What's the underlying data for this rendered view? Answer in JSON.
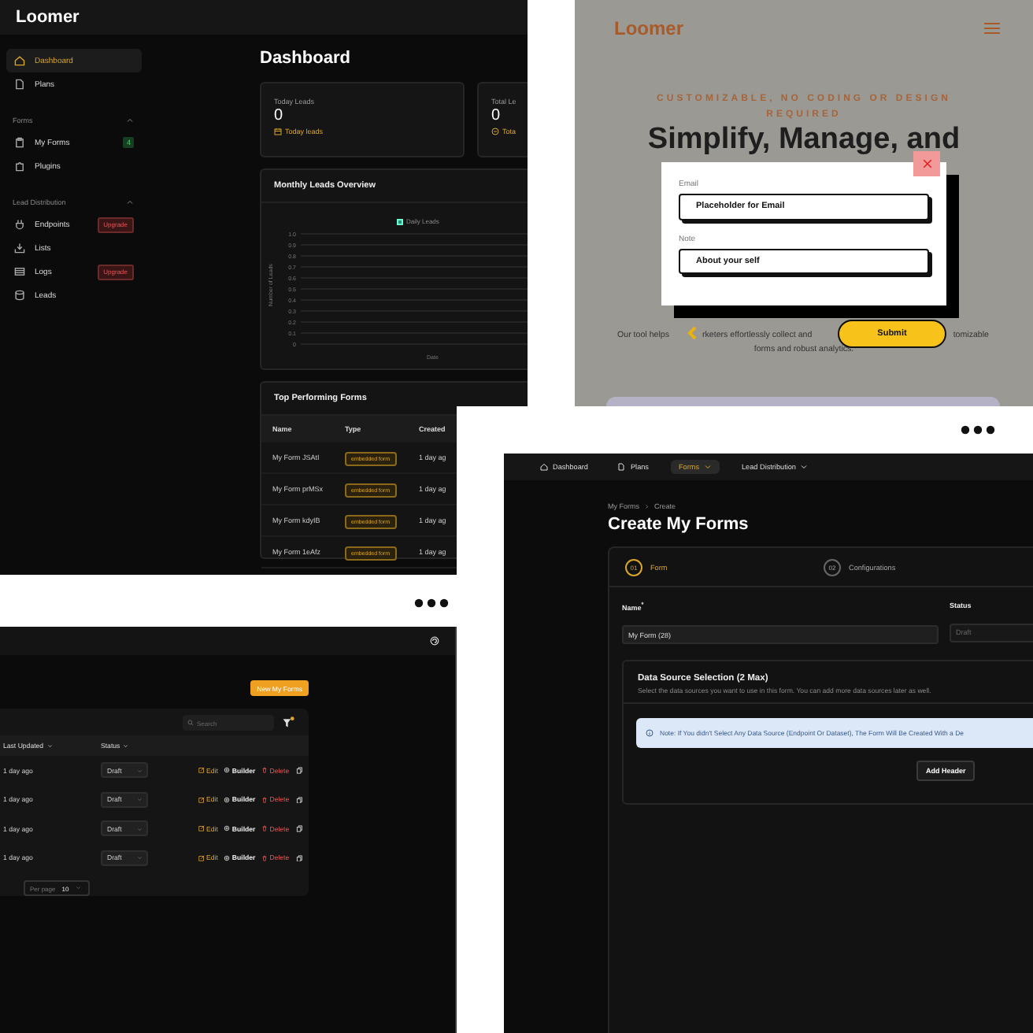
{
  "dashboard_window": {
    "logo": "Loomer",
    "sidebar": {
      "items": [
        {
          "kind": "link",
          "label": "Dashboard",
          "selected": true
        },
        {
          "kind": "link",
          "label": "Plans",
          "selected": false
        },
        {
          "kind": "section",
          "label": "Forms",
          "expanded": true
        },
        {
          "kind": "link",
          "label": "My Forms",
          "selected": false,
          "badge": {
            "kind": "count",
            "text": "4"
          }
        },
        {
          "kind": "link",
          "label": "Plugins",
          "selected": false
        },
        {
          "kind": "section",
          "label": "Lead Distribution",
          "expanded": true
        },
        {
          "kind": "link",
          "label": "Endpoints",
          "selected": false,
          "badge": {
            "kind": "upgrade",
            "text": "Upgrade"
          }
        },
        {
          "kind": "link",
          "label": "Lists",
          "selected": false
        },
        {
          "kind": "link",
          "label": "Logs",
          "selected": false,
          "badge": {
            "kind": "upgrade",
            "text": "Upgrade"
          }
        },
        {
          "kind": "link",
          "label": "Leads",
          "selected": false
        }
      ]
    },
    "title": "Dashboard",
    "stats": [
      {
        "label": "Today Leads",
        "value": "0",
        "caption": "Today leads"
      },
      {
        "label": "Total Le",
        "value": "0",
        "caption": "Tota"
      }
    ],
    "chart": {
      "title": "Monthly Leads Overview",
      "legend": "Daily Leads",
      "ylabel": "Number of Leads",
      "xlabel": "Date",
      "yticks": [
        "1.0",
        "0.9",
        "0.8",
        "0.7",
        "0.6",
        "0.5",
        "0.4",
        "0.3",
        "0.2",
        "0.1",
        "0"
      ]
    },
    "top_forms": {
      "title": "Top Performing Forms",
      "columns": [
        "Name",
        "Type",
        "Created"
      ],
      "rows": [
        {
          "name": "My Form JSAtI",
          "type": "embedded form",
          "created": "1 day ag"
        },
        {
          "name": "My Form prMSx",
          "type": "embedded form",
          "created": "1 day ag"
        },
        {
          "name": "My Form kdyIB",
          "type": "embedded form",
          "created": "1 day ag"
        },
        {
          "name": "My Form 1eAfz",
          "type": "embedded form",
          "created": "1 day ag"
        }
      ]
    }
  },
  "landing_page": {
    "logo": "Loomer",
    "tagline": "CUSTOMIZABLE, NO CODING OR DESIGN REQUIRED",
    "headline": "Simplify, Manage, and",
    "paragraph_fragments": [
      "Our tool helps",
      "rketers effortlessly collect and",
      "tomizable",
      "forms and robust analytics."
    ],
    "modal": {
      "fields": [
        {
          "label": "Email",
          "placeholder": "Placeholder for Email"
        },
        {
          "label": "Note",
          "placeholder": "About your self"
        }
      ],
      "submit": "Submit"
    }
  },
  "forms_window": {
    "new_button": "New My Forms",
    "search": {
      "placeholder": "Search"
    },
    "columns": [
      "Last Updated",
      "Status"
    ],
    "rows": [
      {
        "updated": "1 day ago",
        "status": "Draft",
        "actions": [
          {
            "kind": "edit",
            "label": "Edit"
          },
          {
            "kind": "builder",
            "label": "Builder"
          },
          {
            "kind": "delete",
            "label": "Delete"
          }
        ]
      },
      {
        "updated": "1 day ago",
        "status": "Draft",
        "actions": [
          {
            "kind": "edit",
            "label": "Edit"
          },
          {
            "kind": "builder",
            "label": "Builder"
          },
          {
            "kind": "delete",
            "label": "Delete"
          }
        ]
      },
      {
        "updated": "1 day ago",
        "status": "Draft",
        "actions": [
          {
            "kind": "edit",
            "label": "Edit"
          },
          {
            "kind": "builder",
            "label": "Builder"
          },
          {
            "kind": "delete",
            "label": "Delete"
          }
        ]
      },
      {
        "updated": "1 day ago",
        "status": "Draft",
        "actions": [
          {
            "kind": "edit",
            "label": "Edit"
          },
          {
            "kind": "builder",
            "label": "Builder"
          },
          {
            "kind": "delete",
            "label": "Delete"
          }
        ]
      }
    ],
    "per_page": {
      "label": "Per page",
      "value": "10"
    }
  },
  "create_window": {
    "nav": [
      {
        "label": "Dashboard",
        "selected": false,
        "dropdown": false
      },
      {
        "label": "Plans",
        "selected": false,
        "dropdown": false
      },
      {
        "label": "Forms",
        "selected": true,
        "dropdown": true
      },
      {
        "label": "Lead Distribution",
        "selected": false,
        "dropdown": true
      }
    ],
    "breadcrumb": [
      "My Forms",
      "Create"
    ],
    "title": "Create My Forms",
    "steps": [
      {
        "number": "01",
        "label": "Form",
        "selected": true
      },
      {
        "number": "02",
        "label": "Configurations",
        "selected": false
      }
    ],
    "name_field": {
      "label": "Name$^{*}$",
      "value": "My Form (28)",
      "disabled": false
    },
    "status_field": {
      "label": "Status",
      "value": "Draft",
      "disabled": true
    },
    "data_source": {
      "title": "Data Source Selection (2 Max)",
      "description": "Select the data sources you want to use in this form. You can add more data sources later as well.",
      "note": "Note: If You didn't Select Any Data Source (Endpoint Or Dataset), The Form Will Be Created With a De",
      "button": "Add Header"
    }
  }
}
